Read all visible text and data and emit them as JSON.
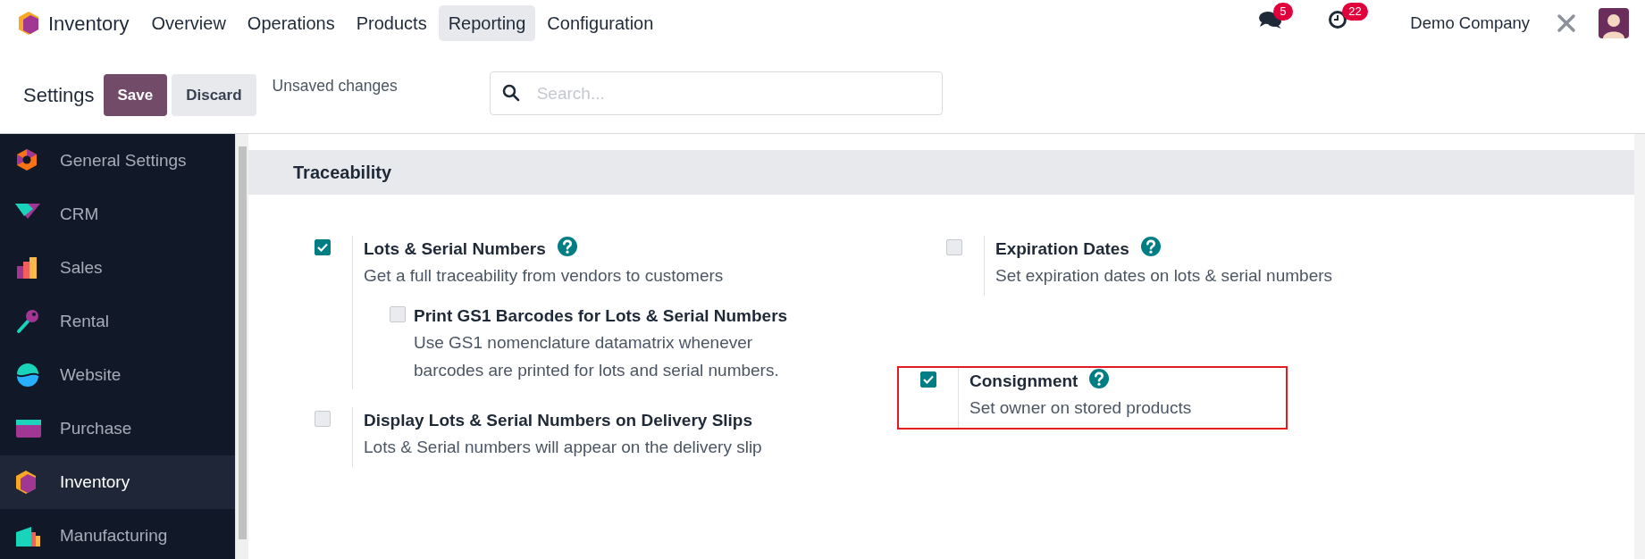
{
  "navbar": {
    "app_name": "Inventory",
    "menu": [
      {
        "label": "Overview",
        "selected": false
      },
      {
        "label": "Operations",
        "selected": false
      },
      {
        "label": "Products",
        "selected": false
      },
      {
        "label": "Reporting",
        "selected": true
      },
      {
        "label": "Configuration",
        "selected": false
      }
    ],
    "messages_count": "5",
    "activities_count": "22",
    "company": "Demo Company"
  },
  "control_panel": {
    "title": "Settings",
    "save": "Save",
    "discard": "Discard",
    "status": "Unsaved changes",
    "search": {
      "placeholder": "Search..."
    }
  },
  "sidebar": {
    "items": [
      {
        "label": "General Settings",
        "kind": "general",
        "selected": false
      },
      {
        "label": "CRM",
        "kind": "crm",
        "selected": false
      },
      {
        "label": "Sales",
        "kind": "sales",
        "selected": false
      },
      {
        "label": "Rental",
        "kind": "rental",
        "selected": false
      },
      {
        "label": "Website",
        "kind": "website",
        "selected": false
      },
      {
        "label": "Purchase",
        "kind": "purchase",
        "selected": false
      },
      {
        "label": "Inventory",
        "kind": "inventory",
        "selected": true
      },
      {
        "label": "Manufacturing",
        "kind": "manufacturing",
        "selected": false
      }
    ]
  },
  "section": {
    "title": "Traceability",
    "settings": [
      {
        "title": "Lots & Serial Numbers",
        "description": "Get a full traceability from vendors to customers",
        "checked": true,
        "help": true,
        "highlighted": false,
        "children": [
          {
            "title": "Print GS1 Barcodes for Lots & Serial Numbers",
            "description": "Use GS1 nomenclature datamatrix whenever barcodes are printed for lots and serial numbers.",
            "checked": false
          }
        ]
      },
      {
        "title": "Expiration Dates",
        "description": "Set expiration dates on lots & serial numbers",
        "checked": false,
        "help": true,
        "highlighted": false
      },
      {
        "title": "Display Lots & Serial Numbers on Delivery Slips",
        "description": "Lots & Serial numbers will appear on the delivery slip",
        "checked": false,
        "help": false,
        "highlighted": false
      },
      {
        "title": "Consignment",
        "description": "Set owner on stored products",
        "checked": true,
        "help": true,
        "highlighted": true
      }
    ]
  }
}
